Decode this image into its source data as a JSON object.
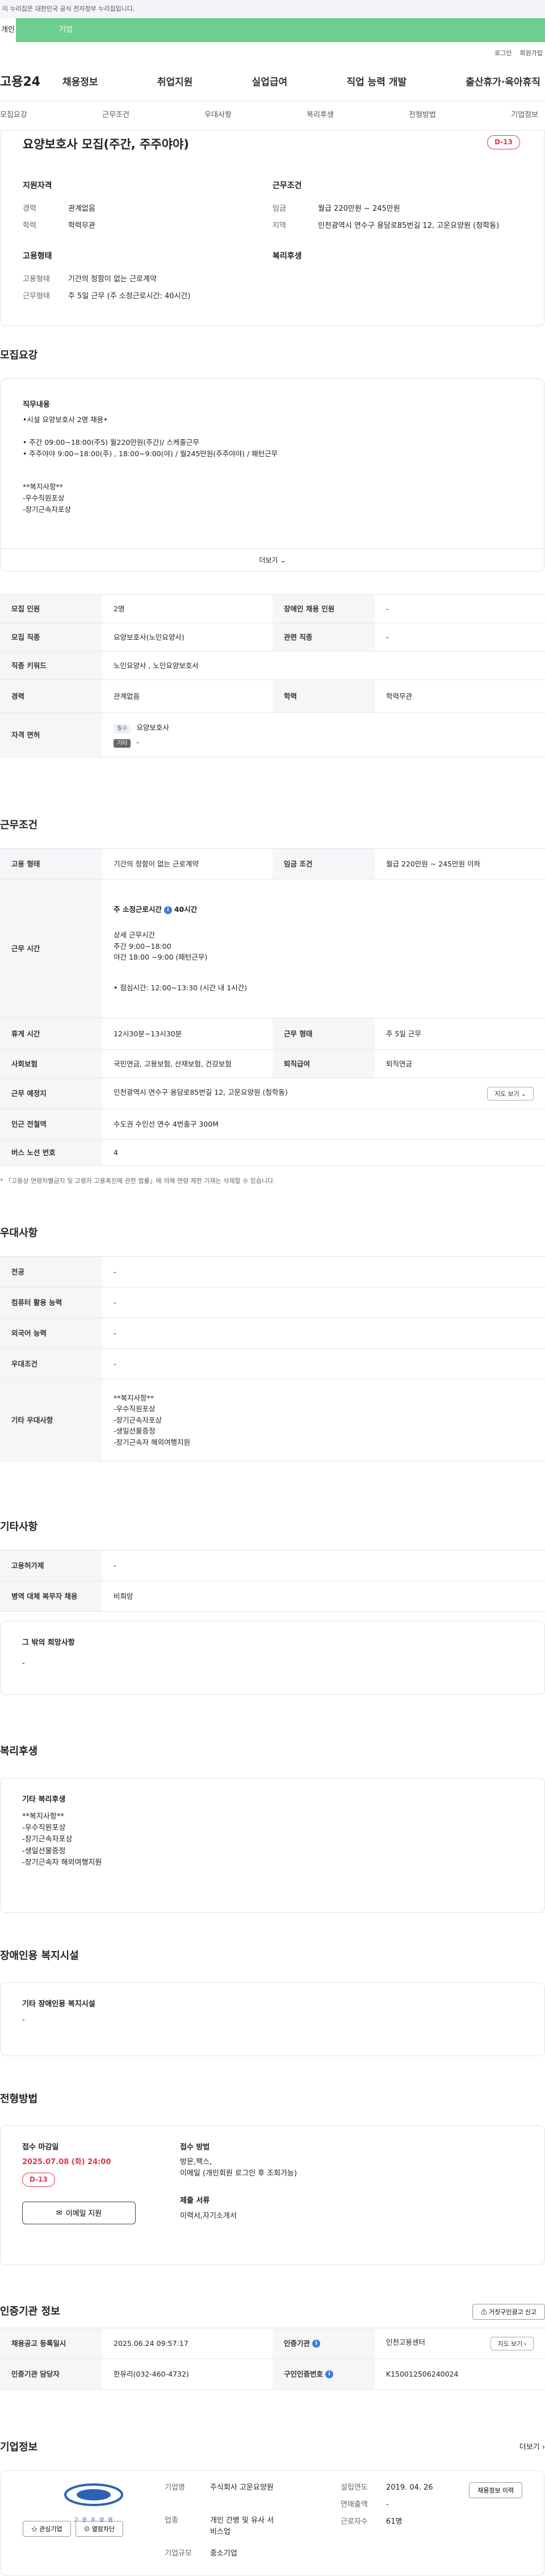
{
  "gov_banner": "이 누리집은 대한민국 공식 전자정부 누리집입니다.",
  "user_tabs": [
    "개인",
    "기업"
  ],
  "util": [
    "로그인",
    "회원가입"
  ],
  "logo": "고용24",
  "gnb": [
    "채용정보",
    "취업지원",
    "실업급여",
    "직업 능력 개발",
    "출산휴가·육아휴직"
  ],
  "anchors": [
    "모집요강",
    "근무조건",
    "우대사항",
    "복리후생",
    "전형방법",
    "기업정보"
  ],
  "summary": {
    "title": "요양보호사 모집(주간, 주주야야)",
    "dday": "D-13",
    "qual_h": "지원자격",
    "career_k": "경력",
    "career_v": "관계없음",
    "edu_k": "학력",
    "edu_v": "학력무관",
    "cond_h": "근무조건",
    "wage_k": "임금",
    "wage_v": "월급 220만원 ~ 245만원",
    "area_k": "지역",
    "area_v": "인천광역시 연수구 용담로85번길 12, 고운요양원 (청학동)",
    "emp_h": "고용형태",
    "type_k": "고용형태",
    "type_v": "기간의 정함이 없는 근로계약",
    "hours_k": "근무형태",
    "hours_v": "주 5일 근무 (주 소정근로시간: 40시간)",
    "welfare_h": "복리후생"
  },
  "recruit": {
    "title": "모집요강",
    "duty_h": "직무내용",
    "duty": [
      "•시설 요양보호사 2명 채용•",
      "• 주간 09:00~18:00(주5) 월220만원(주간)/ 스케줄근무",
      "• 주주야야  9:00~18:00(주) , 18:00~9:00(야) / 월245만원(주주야야) / 패턴근무",
      "",
      "**복지사항**",
      "-우수직원포상",
      "-장기근속자포상"
    ],
    "more": "더보기",
    "rows": [
      {
        "k1": "모집 인원",
        "v1": "2명",
        "k2": "장애인 채용 인원",
        "v2": "-"
      },
      {
        "k1": "모집 직종",
        "v1": "요양보호사(노인요양사)",
        "k2": "관련 직종",
        "v2": "-"
      },
      {
        "k1": "직종 키워드",
        "v1": "노인요양사 , 노인요양보호사"
      },
      {
        "k1": "경력",
        "v1": "관계없음",
        "k2": "학력",
        "v2": "학력무관"
      }
    ],
    "license_k": "자격 면허",
    "license_tag": "필수",
    "license_v": "요양보호사",
    "license_tag2": "기타",
    "license_v2": "-"
  },
  "work": {
    "title": "근무조건",
    "type_k": "고용 형태",
    "type_v": "기간의 정함이 없는 근로계약",
    "wage_k": "임금 조건",
    "wage_v": "월급 220만원 ~ 245만원 이하",
    "time_k": "근무 시간",
    "time_main": "주 소정근로시간",
    "time_hours": "40시간",
    "time_detail_h": "상세 근무시간",
    "time_detail": [
      "주간 9:00~18:00",
      "야간 18:00 ~9:00 (패턴근무)",
      "",
      "• 점심시간: 12:00~13:30 (시간 내 1시간)"
    ],
    "break_k": "휴게 시간",
    "break_v": "12시30분~13시30분",
    "form_k": "근무 형태",
    "form_v": "주 5일 근무",
    "ins_k": "사회보험",
    "ins_v": "국민연금, 고용보험, 산재보험, 건강보험",
    "ret_k": "퇴직급여",
    "ret_v": "퇴직연금",
    "place_k": "근무 예정지",
    "place_v": "인천광역시 연수구 용담로85번길 12, 고운요양원 (청학동)",
    "map": "지도 보기",
    "station_k": "인근 전철역",
    "station_v": "수도권 수인선 연수 4번출구 300M",
    "bus_k": "버스 노선 번호",
    "bus_v": "4",
    "note": "* 「고용상 연령차별금지 및 고령자 고용촉진에 관한 법률」에 의해 연령 제한 기재는 삭제할 수 있습니다."
  },
  "prefer": {
    "title": "우대사항",
    "rows": [
      {
        "k": "전공",
        "v": "-"
      },
      {
        "k": "컴퓨터 활용 능력",
        "v": "-"
      },
      {
        "k": "외국어 능력",
        "v": "-"
      },
      {
        "k": "우대조건",
        "v": "-"
      }
    ],
    "etc_k": "기타 우대사항",
    "etc_v": [
      "**복지사항**",
      "-우수직원포상",
      "-장기근속자포상",
      "-생일선물증정",
      "-장기근속자 해외여행지원"
    ]
  },
  "other": {
    "title": "기타사항",
    "rows": [
      {
        "k": "고용허가제",
        "v": "-"
      },
      {
        "k": "병역 대체 복무자 채용",
        "v": "비희망"
      }
    ],
    "hope_h": "그 밖의 희망사항",
    "hope_v": "-"
  },
  "welfare": {
    "title": "복리후생",
    "h": "기타 복리후생",
    "lines": [
      "**복지사항**",
      "-우수직원포상",
      "-장기근속자포상",
      "-생일선물증정",
      "-장기근속자 해외여행지원"
    ]
  },
  "disabled": {
    "title": "장애인용 복지시설",
    "h": "기타 장애인용 복지시설",
    "v": "-"
  },
  "screening": {
    "title": "전형방법",
    "deadline_h": "접수 마감일",
    "deadline_v": "2025.07.08 (화) 24:00",
    "dday": "D-13",
    "email_btn": "이메일 지원",
    "method_h": "접수 방법",
    "method_v": [
      "방문,팩스,",
      "이메일 (개인회원 로그인 후 조회가능)"
    ],
    "docs_h": "제출 서류",
    "docs_v": "이력서,자기소개서"
  },
  "cert": {
    "title": "인증기관 정보",
    "report": "거짓구인광고 신고",
    "r1k1": "채용공고 등록일시",
    "r1v1": "2025.06.24 09:57:17",
    "r1k2": "인증기관",
    "r1v2": "인천고용센터",
    "map": "지도 보기",
    "r2k1": "인증기관 담당자",
    "r2v1": "한유리(032-460-4732)",
    "r2k2": "구인인증번호",
    "r2v2": "K150012506240024"
  },
  "company": {
    "title": "기업정보",
    "more": "더보기",
    "logo_text": "고 운 요 양 원",
    "fav": "관심기업",
    "block": "열람차단",
    "name_k": "기업명",
    "name_v": "주식회사 고운요양원",
    "est_k": "설립연도",
    "est_v": "2019. 04. 26",
    "info_btn": "채용정보 이력",
    "ind_k": "업종",
    "ind_v": "개인 간병 및 유사 서비스업",
    "sales_k": "연매출액",
    "sales_v": "-",
    "emp_k": "근로자수",
    "emp_v": "61명",
    "size_k": "기업규모",
    "size_v": "중소기업"
  },
  "colors": {
    "accent": "#6ccf8f",
    "dday": "#e0394b",
    "border": "#dfe3ea"
  }
}
